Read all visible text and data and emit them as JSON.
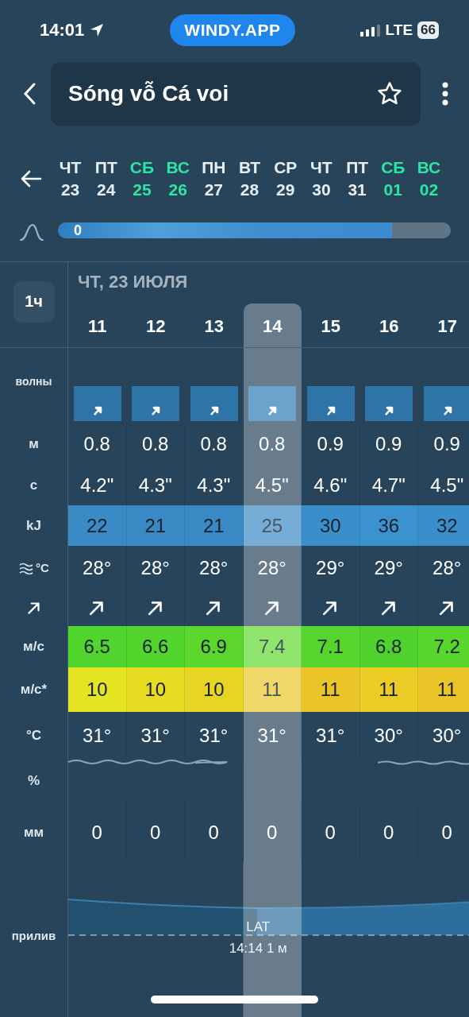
{
  "status_bar": {
    "time": "14:01",
    "app_pill": "WINDY.APP",
    "network": "LTE",
    "battery": "66"
  },
  "header": {
    "title": "Sóng vỗ Cá voi",
    "favorite": false
  },
  "days": [
    {
      "dow": "ЧТ",
      "date": "23",
      "weekend": false
    },
    {
      "dow": "ПТ",
      "date": "24",
      "weekend": false
    },
    {
      "dow": "СБ",
      "date": "25",
      "weekend": true
    },
    {
      "dow": "ВС",
      "date": "26",
      "weekend": true
    },
    {
      "dow": "ПН",
      "date": "27",
      "weekend": false
    },
    {
      "dow": "ВТ",
      "date": "28",
      "weekend": false
    },
    {
      "dow": "СР",
      "date": "29",
      "weekend": false
    },
    {
      "dow": "ЧТ",
      "date": "30",
      "weekend": false
    },
    {
      "dow": "ПТ",
      "date": "31",
      "weekend": false
    },
    {
      "dow": "СБ",
      "date": "01",
      "weekend": true
    },
    {
      "dow": "ВС",
      "date": "02",
      "weekend": true
    }
  ],
  "timeline": {
    "level": 0.85,
    "thumb_label": "0"
  },
  "step_button": "1ч",
  "date_label": "ЧТ, 23 ИЮЛЯ",
  "hours": [
    {
      "label": "11",
      "selected": false
    },
    {
      "label": "12",
      "selected": false
    },
    {
      "label": "13",
      "selected": false
    },
    {
      "label": "14",
      "selected": true
    },
    {
      "label": "15",
      "selected": false
    },
    {
      "label": "16",
      "selected": false
    },
    {
      "label": "17",
      "selected": false
    }
  ],
  "rows": [
    {
      "kind": "waves",
      "label": "волны"
    },
    {
      "kind": "text",
      "label": "м",
      "values": [
        "0.8",
        "0.8",
        "0.8",
        "0.8",
        "0.9",
        "0.9",
        "0.9"
      ]
    },
    {
      "kind": "text",
      "label": "с",
      "values": [
        "4.2\"",
        "4.3\"",
        "4.3\"",
        "4.5\"",
        "4.6\"",
        "4.7\"",
        "4.5\""
      ]
    },
    {
      "kind": "colored",
      "label": "kJ",
      "cells": [
        {
          "text": "22",
          "color": "#3a8ac6"
        },
        {
          "text": "21",
          "color": "#3a88c4"
        },
        {
          "text": "21",
          "color": "#3a88c4"
        },
        {
          "text": "25",
          "color": "#75add7"
        },
        {
          "text": "30",
          "color": "#3a8fcb"
        },
        {
          "text": "36",
          "color": "#3a92ce"
        },
        {
          "text": "32",
          "color": "#3a8fcb"
        }
      ]
    },
    {
      "kind": "water_temp",
      "label": "°C",
      "values": [
        "28°",
        "28°",
        "28°",
        "28°",
        "29°",
        "29°",
        "28°"
      ]
    },
    {
      "kind": "direction"
    },
    {
      "kind": "colored",
      "label": "м/с",
      "cells": [
        {
          "text": "6.5",
          "color": "#4fd52c"
        },
        {
          "text": "6.6",
          "color": "#52d52c"
        },
        {
          "text": "6.9",
          "color": "#5bd62c"
        },
        {
          "text": "7.4",
          "color": "#8ee46d"
        },
        {
          "text": "7.1",
          "color": "#56d62c"
        },
        {
          "text": "6.8",
          "color": "#4fd32c"
        },
        {
          "text": "7.2",
          "color": "#58d62c"
        }
      ]
    },
    {
      "kind": "colored",
      "label": "м/с*",
      "cells": [
        {
          "text": "10",
          "color": "#e4e423"
        },
        {
          "text": "10",
          "color": "#e8dc22"
        },
        {
          "text": "10",
          "color": "#e8d422"
        },
        {
          "text": "11",
          "color": "#f1d668"
        },
        {
          "text": "11",
          "color": "#ebc428"
        },
        {
          "text": "11",
          "color": "#ebcc24"
        },
        {
          "text": "11",
          "color": "#ebc428"
        }
      ]
    },
    {
      "kind": "text",
      "label": "°C",
      "values": [
        "31°",
        "31°",
        "31°",
        "31°",
        "31°",
        "30°",
        "30°"
      ]
    },
    {
      "kind": "cloud",
      "label": "%"
    },
    {
      "kind": "text",
      "label": "мм",
      "values": [
        "0",
        "0",
        "0",
        "0",
        "0",
        "0",
        "0"
      ]
    },
    {
      "kind": "tide",
      "label": "прилив",
      "marker": "LAT",
      "reading": "14:14 1 м"
    }
  ]
}
